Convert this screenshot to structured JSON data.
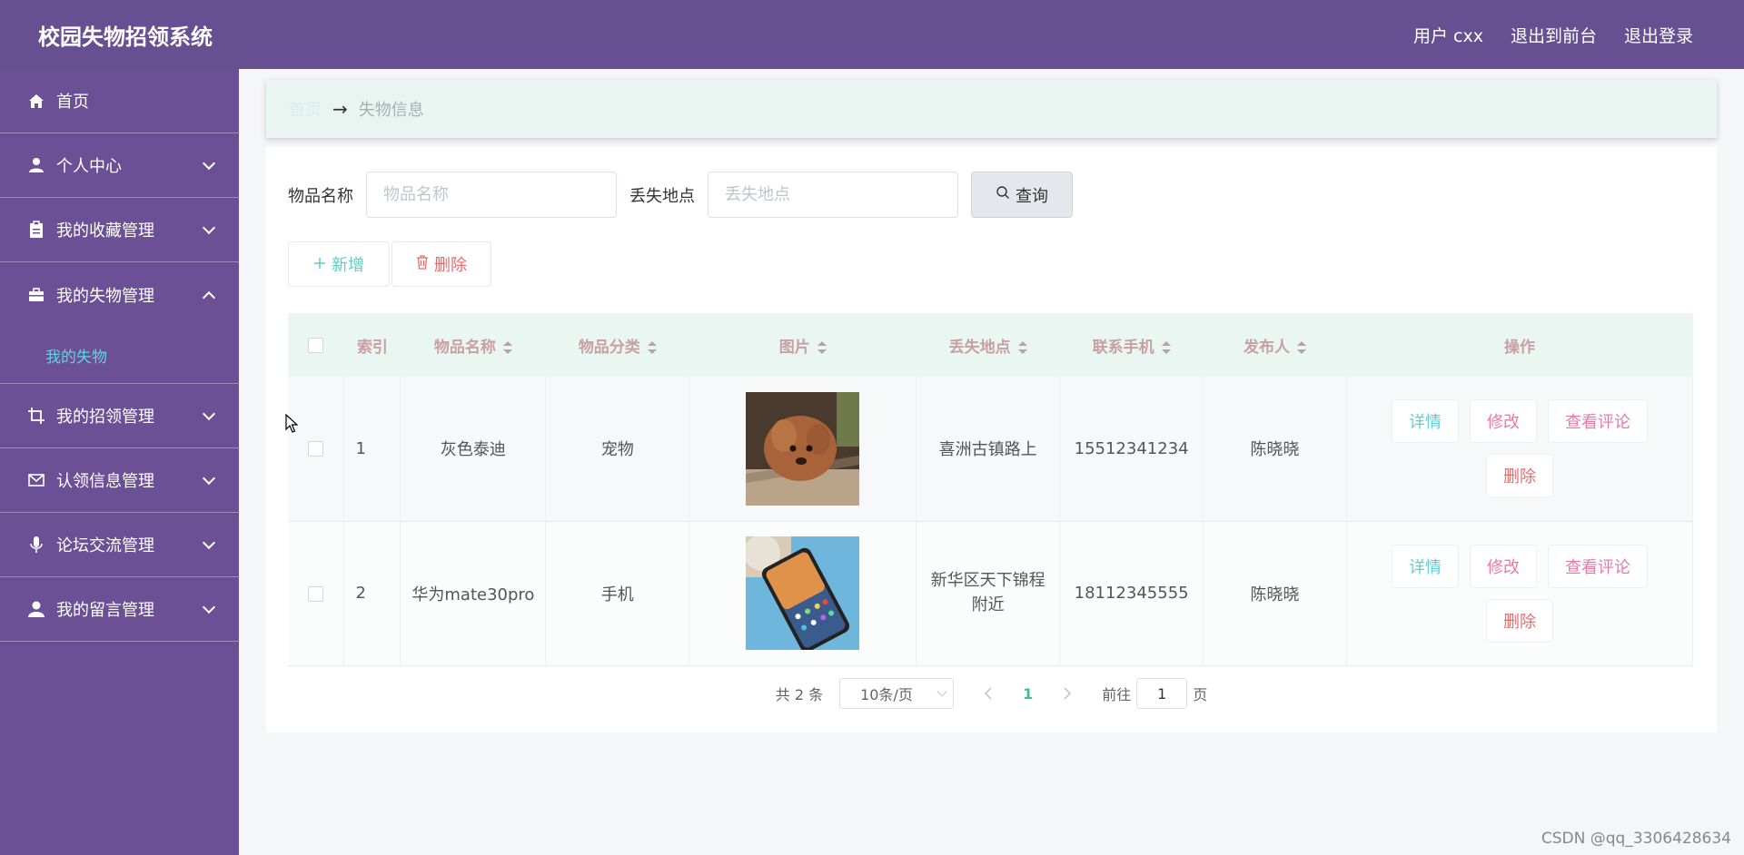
{
  "header": {
    "title": "校园失物招领系统",
    "user_label": "用户 cxx",
    "to_front": "退出到前台",
    "logout": "退出登录"
  },
  "sidebar": {
    "items": [
      {
        "label": "首页",
        "icon": "home-icon"
      },
      {
        "label": "个人中心",
        "icon": "user-icon"
      },
      {
        "label": "我的收藏管理",
        "icon": "clipboard-icon"
      },
      {
        "label": "我的失物管理",
        "icon": "briefcase-icon"
      },
      {
        "label": "我的招领管理",
        "icon": "crop-icon"
      },
      {
        "label": "认领信息管理",
        "icon": "mail-icon"
      },
      {
        "label": "论坛交流管理",
        "icon": "microphone-icon"
      },
      {
        "label": "我的留言管理",
        "icon": "person-icon"
      }
    ],
    "submenu_active": "我的失物"
  },
  "breadcrumb": {
    "home": "首页",
    "arrow": "→",
    "current": "失物信息"
  },
  "search": {
    "name_label": "物品名称",
    "name_placeholder": "物品名称",
    "place_label": "丢失地点",
    "place_placeholder": "丢失地点",
    "query_button": "查询"
  },
  "actions": {
    "add": "新增",
    "delete": "删除"
  },
  "table": {
    "headers": [
      "索引",
      "物品名称",
      "物品分类",
      "图片",
      "丢失地点",
      "联系手机",
      "发布人",
      "操作"
    ],
    "rows": [
      {
        "index": "1",
        "name": "灰色泰迪",
        "category": "宠物",
        "image": "poodle-photo",
        "place": "喜洲古镇路上",
        "phone": "15512341234",
        "publisher": "陈晓晓"
      },
      {
        "index": "2",
        "name": "华为mate30pro",
        "category": "手机",
        "image": "phone-photo",
        "place": "新华区天下锦程附近",
        "phone": "18112345555",
        "publisher": "陈晓晓"
      }
    ],
    "ops": {
      "detail": "详情",
      "edit": "修改",
      "comments": "查看评论",
      "delete": "删除"
    }
  },
  "pagination": {
    "total": "共 2 条",
    "page_size": "10条/页",
    "current_page": "1",
    "goto_label": "前往",
    "goto_value": "1",
    "page_suffix": "页"
  },
  "watermark": "CSDN @qq_3306428634",
  "colors": {
    "header_bg": "#665091",
    "sidebar_bg": "#6b5096",
    "active_submenu": "#5fd3e0",
    "table_header_bg": "#e9f6f2",
    "current_page": "#3cc08f"
  }
}
